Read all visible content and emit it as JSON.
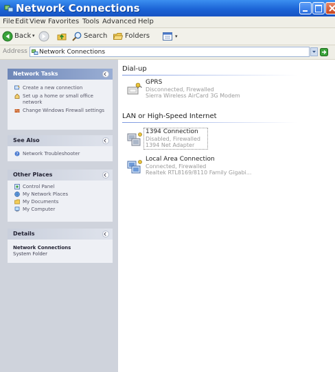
{
  "window": {
    "title": "Network Connections"
  },
  "menu": [
    "File",
    "Edit",
    "View",
    "Favorites",
    "Tools",
    "Advanced",
    "Help"
  ],
  "toolbar": {
    "back": "Back",
    "search": "Search",
    "folders": "Folders"
  },
  "address": {
    "label": "Address",
    "value": "Network Connections"
  },
  "sidebar": {
    "network_tasks": {
      "title": "Network Tasks",
      "items": [
        "Create a new connection",
        "Set up a home or small office network",
        "Change Windows Firewall settings"
      ]
    },
    "see_also": {
      "title": "See Also",
      "items": [
        "Network Troubleshooter"
      ]
    },
    "other_places": {
      "title": "Other Places",
      "items": [
        "Control Panel",
        "My Network Places",
        "My Documents",
        "My Computer"
      ]
    },
    "details": {
      "title": "Details",
      "name": "Network Connections",
      "type": "System Folder"
    }
  },
  "content": {
    "dialup": {
      "title": "Dial-up",
      "items": [
        {
          "name": "GPRS",
          "status": "Disconnected, Firewalled",
          "device": "Sierra Wireless AirCard 3G Modem"
        }
      ]
    },
    "lan": {
      "title": "LAN or High-Speed Internet",
      "items": [
        {
          "name": "1394 Connection",
          "status": "Disabled, Firewalled",
          "device": "1394 Net Adapter"
        },
        {
          "name": "Local Area Connection",
          "status": "Connected, Firewalled",
          "device": "Realtek RTL8169/8110 Family Gigabi..."
        }
      ]
    }
  },
  "colors": {
    "titlebar": "#1c64d6",
    "sidebar": "#cfd3dc",
    "panel": "#eef0f5",
    "section_line": "#7a96df",
    "muted_text": "#9a9a9a"
  }
}
